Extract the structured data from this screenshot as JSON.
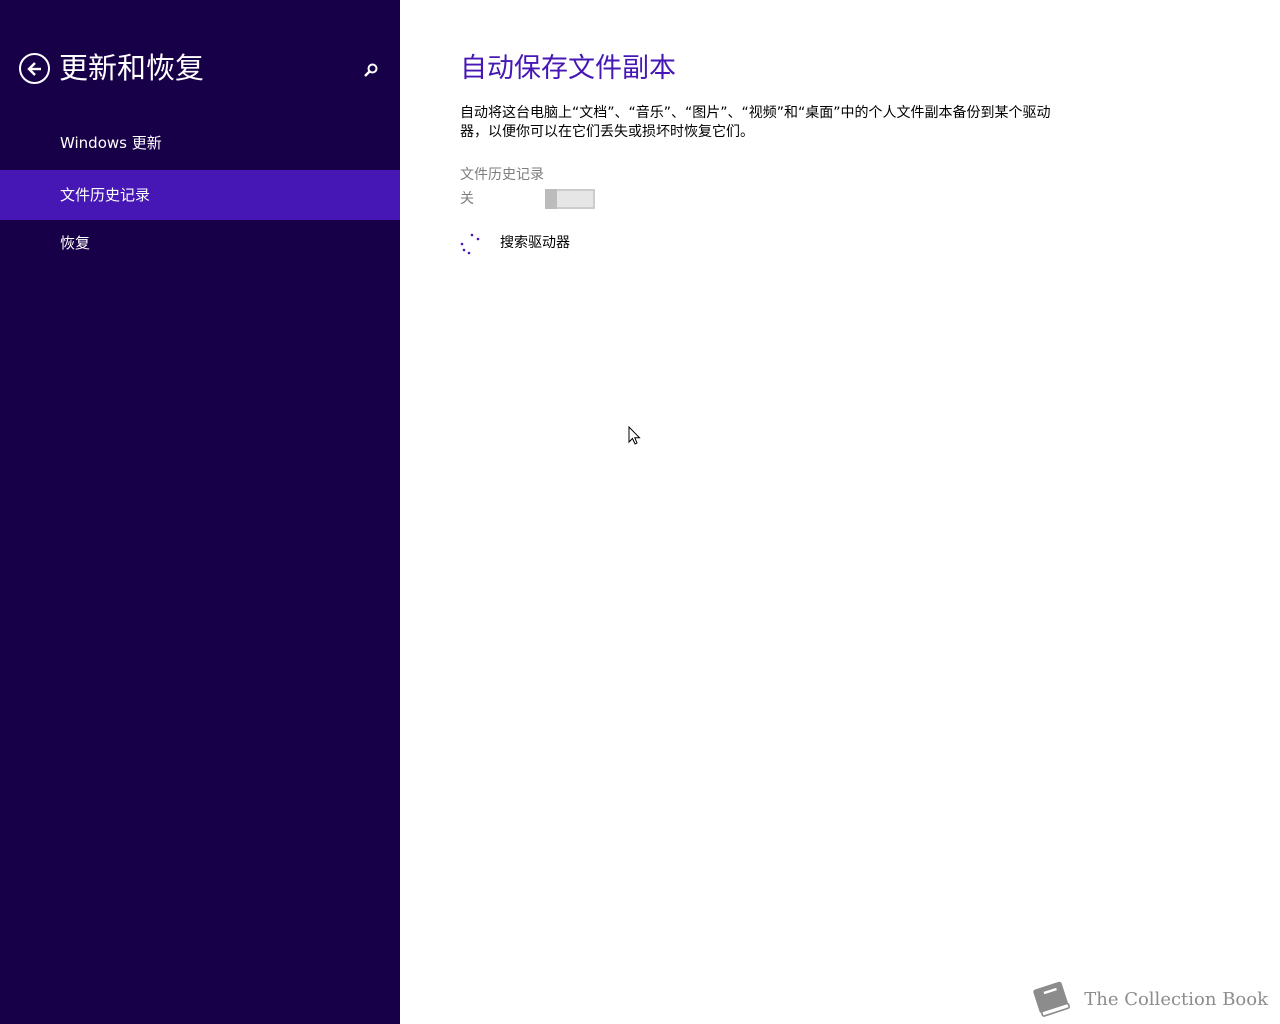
{
  "sidebar": {
    "title": "更新和恢复",
    "items": [
      {
        "label": "Windows 更新",
        "selected": false
      },
      {
        "label": "文件历史记录",
        "selected": true
      },
      {
        "label": "恢复",
        "selected": false
      }
    ]
  },
  "main": {
    "title": "自动保存文件副本",
    "description": "自动将这台电脑上“文档”、“音乐”、“图片”、“视频”和“桌面”中的个人文件副本备份到某个驱动器，以便你可以在它们丢失或损坏时恢复它们。",
    "file_history": {
      "label": "文件历史记录",
      "state_text": "关",
      "enabled": false
    },
    "search_status": "搜索驱动器"
  },
  "watermark": {
    "text": "The Collection Book"
  },
  "colors": {
    "sidebar_bg": "#180048",
    "sidebar_selected": "#4617b4",
    "accent": "#4617b4"
  },
  "icons": {
    "back": "back-arrow-circle-icon",
    "search": "search-icon",
    "spinner": "loading-spinner-icon",
    "cursor": "mouse-cursor-icon",
    "book": "book-icon"
  }
}
